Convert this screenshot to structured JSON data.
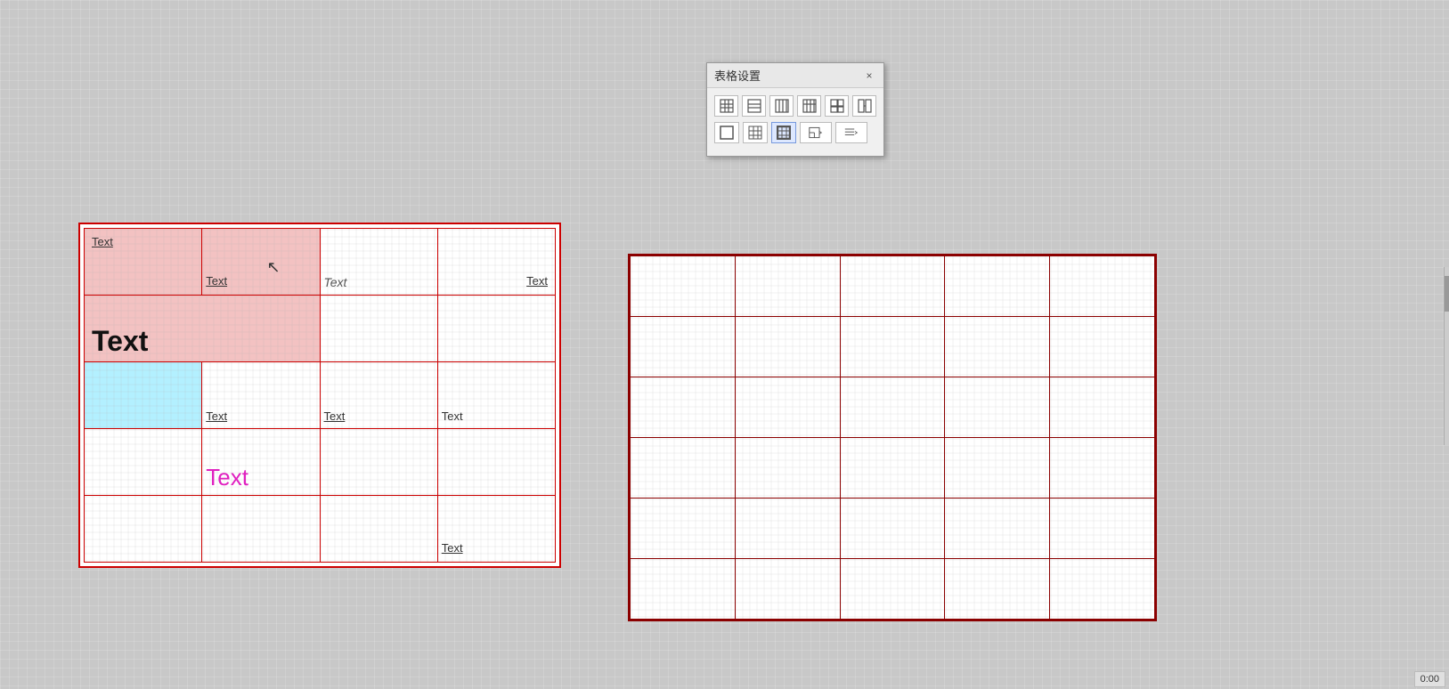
{
  "dialog": {
    "title": "表格设置",
    "close_label": "×",
    "row1_buttons": [
      {
        "id": "btn-grid1",
        "icon": "grid1"
      },
      {
        "id": "btn-grid2",
        "icon": "grid2"
      },
      {
        "id": "btn-grid3",
        "icon": "grid3"
      },
      {
        "id": "btn-grid4",
        "icon": "grid4"
      },
      {
        "id": "btn-grid5",
        "icon": "grid5"
      },
      {
        "id": "btn-grid6",
        "icon": "grid6"
      }
    ],
    "row2_buttons": [
      {
        "id": "btn-table1",
        "icon": "table1"
      },
      {
        "id": "btn-table2",
        "icon": "table2"
      },
      {
        "id": "btn-table3",
        "icon": "table3",
        "active": true
      },
      {
        "id": "btn-align1",
        "icon": "align1"
      },
      {
        "id": "btn-lines1",
        "icon": "lines1"
      }
    ]
  },
  "left_table": {
    "cells": [
      [
        {
          "text": "Text",
          "style": "underline",
          "bg": "pink"
        },
        {
          "text": "Text",
          "style": "underline",
          "bg": "pink",
          "cursor": true
        },
        {
          "text": "Text",
          "style": "italic",
          "bg": "none"
        },
        {
          "text": "Text",
          "style": "underline",
          "bg": "none",
          "align": "right"
        }
      ],
      [
        {
          "text": "Text",
          "style": "bold",
          "bg": "pink",
          "colspan": 2
        },
        {
          "text": "",
          "bg": "none"
        },
        {
          "text": "",
          "bg": "none"
        }
      ],
      [
        {
          "text": "",
          "bg": "light-blue"
        },
        {
          "text": "Text",
          "style": "underline",
          "bg": "none"
        },
        {
          "text": "Text",
          "style": "underline",
          "bg": "none"
        },
        {
          "text": "Text",
          "style": "normal",
          "bg": "none"
        }
      ],
      [
        {
          "text": "",
          "bg": "none"
        },
        {
          "text": "Text",
          "style": "magenta",
          "bg": "none"
        },
        {
          "text": "",
          "bg": "none"
        },
        {
          "text": "",
          "bg": "none"
        }
      ],
      [
        {
          "text": "",
          "bg": "none"
        },
        {
          "text": "",
          "bg": "none"
        },
        {
          "text": "",
          "bg": "none"
        },
        {
          "text": "Text",
          "style": "underline",
          "bg": "none"
        }
      ]
    ]
  },
  "right_table": {
    "rows": 6,
    "cols": 5
  },
  "clock": {
    "time": "0:00"
  }
}
